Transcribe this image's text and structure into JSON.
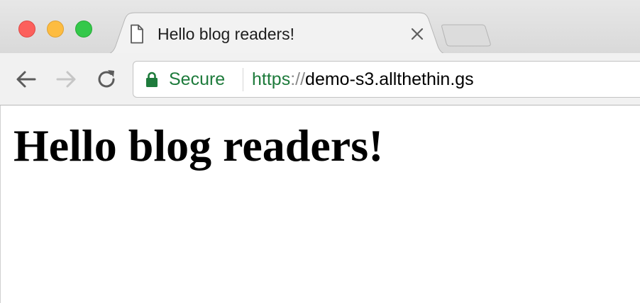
{
  "tab": {
    "title": "Hello blog readers!",
    "favicon": "document-icon"
  },
  "window_controls": [
    "close-icon",
    "minimize-icon",
    "maximize-icon"
  ],
  "toolbar": {
    "back_icon": "back-arrow-icon",
    "forward_icon": "forward-arrow-icon",
    "reload_icon": "reload-icon"
  },
  "omnibox": {
    "security_label": "Secure",
    "security_icon": "lock-icon",
    "url_scheme": "https",
    "url_separator": "://",
    "url_host": "demo-s3.allthethin.gs"
  },
  "page": {
    "heading": "Hello blog readers!"
  },
  "colors": {
    "secure_green": "#1e7b3c",
    "close": "#fc605c",
    "minimize": "#fdbc40",
    "maximize": "#34c84a"
  }
}
